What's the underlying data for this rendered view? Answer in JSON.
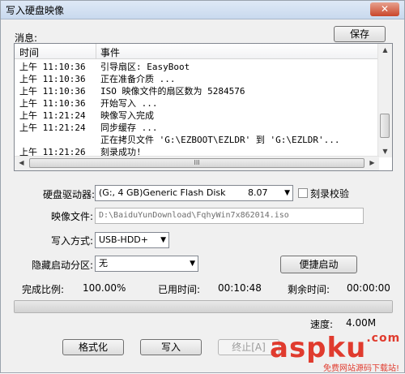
{
  "window": {
    "title": "写入硬盘映像",
    "close_glyph": "✕"
  },
  "log": {
    "label": "消息:",
    "save_label": "保存",
    "col_time": "时间",
    "col_event": "事件",
    "rows": [
      {
        "time": "上午 11:10:36",
        "event": "引导扇区: EasyBoot"
      },
      {
        "time": "上午 11:10:36",
        "event": "正在准备介质 ..."
      },
      {
        "time": "上午 11:10:36",
        "event": "ISO 映像文件的扇区数为 5284576"
      },
      {
        "time": "上午 11:10:36",
        "event": "开始写入 ..."
      },
      {
        "time": "上午 11:21:24",
        "event": "映像写入完成"
      },
      {
        "time": "上午 11:21:24",
        "event": "同步缓存 ..."
      },
      {
        "time": "",
        "event": "正在拷贝文件 'G:\\EZBOOT\\EZLDR' 到 'G:\\EZLDR'..."
      },
      {
        "time": "上午 11:21:26",
        "event": "刻录成功!"
      }
    ],
    "hscroll_grip": "III"
  },
  "form": {
    "drive_label": "硬盘驱动器:",
    "drive_value": "(G:, 4 GB)Generic Flash Disk",
    "drive_version": "8.07",
    "verify_label": "刻录校验",
    "verify_checked": false,
    "image_label": "映像文件:",
    "image_path": "D:\\BaiduYunDownload\\FqhyWin7x862014.iso",
    "method_label": "写入方式:",
    "method_value": "USB-HDD+",
    "hidden_label": "隐藏启动分区:",
    "hidden_value": "无",
    "quick_boot_label": "便捷启动"
  },
  "status": {
    "percent_label": "完成比例:",
    "percent_value": "100.00%",
    "elapsed_label": "已用时间:",
    "elapsed_value": "00:10:48",
    "remaining_label": "剩余时间:",
    "remaining_value": "00:00:00",
    "progress": 1.0,
    "speed_label": "速度:",
    "speed_value": "4.00M"
  },
  "buttons": {
    "format": "格式化",
    "write": "写入",
    "stop": "终止[A]"
  },
  "watermark": {
    "text": "aspku",
    "suffix": ".com",
    "sub": "免费网站源码下载站!"
  },
  "colors": {
    "watermark": "#e03b2e",
    "title_gradient_top": "#dfe9f6"
  }
}
